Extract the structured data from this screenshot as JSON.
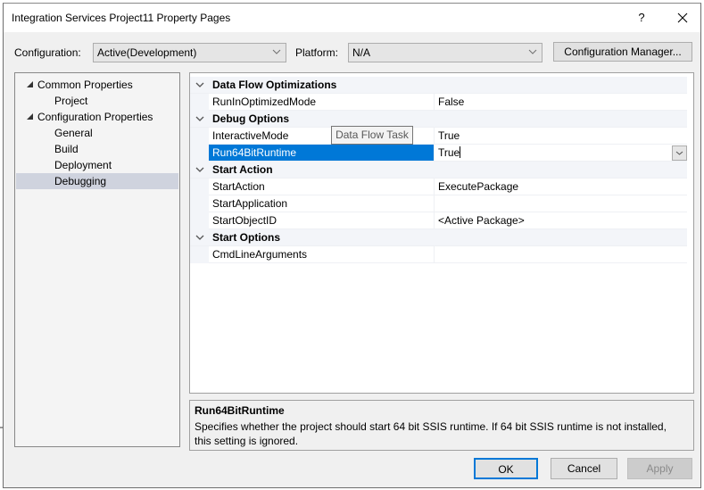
{
  "window": {
    "title": "Integration Services Project11 Property Pages",
    "help_label": "?",
    "close_label": "✕"
  },
  "toolbar": {
    "configuration_label": "Configuration:",
    "configuration_value": "Active(Development)",
    "platform_label": "Platform:",
    "platform_value": "N/A",
    "config_manager_label": "Configuration Manager..."
  },
  "tree": {
    "items": [
      {
        "label": "Common Properties",
        "level": 0,
        "expanded": true
      },
      {
        "label": "Project",
        "level": 1
      },
      {
        "label": "Configuration Properties",
        "level": 0,
        "expanded": true
      },
      {
        "label": "General",
        "level": 1
      },
      {
        "label": "Build",
        "level": 1
      },
      {
        "label": "Deployment",
        "level": 1
      },
      {
        "label": "Debugging",
        "level": 1,
        "selected": true
      }
    ]
  },
  "grid": {
    "rows": [
      {
        "type": "category",
        "label": "Data Flow Optimizations"
      },
      {
        "type": "property",
        "name": "RunInOptimizedMode",
        "value": "False"
      },
      {
        "type": "category",
        "label": "Debug Options"
      },
      {
        "type": "property",
        "name": "InteractiveMode",
        "value": "True"
      },
      {
        "type": "property",
        "name": "Run64BitRuntime",
        "value": "True",
        "selected": true
      },
      {
        "type": "category",
        "label": "Start Action"
      },
      {
        "type": "property",
        "name": "StartAction",
        "value": "ExecutePackage"
      },
      {
        "type": "property",
        "name": "StartApplication",
        "value": ""
      },
      {
        "type": "property",
        "name": "StartObjectID",
        "value": "<Active Package>"
      },
      {
        "type": "category",
        "label": "Start Options"
      },
      {
        "type": "property",
        "name": "CmdLineArguments",
        "value": ""
      }
    ],
    "tooltip": "Data Flow Task"
  },
  "description": {
    "title": "Run64BitRuntime",
    "text": "Specifies whether the project should start 64 bit SSIS runtime. If 64 bit SSIS runtime is not installed, this setting is ignored."
  },
  "buttons": {
    "ok": "OK",
    "cancel": "Cancel",
    "apply": "Apply"
  },
  "colors": {
    "selection": "#0078d7",
    "tree_selection": "#cfd3de",
    "category_bg": "#f3f5f9"
  }
}
